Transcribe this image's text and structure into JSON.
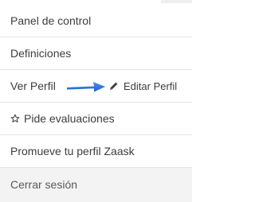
{
  "menu": {
    "items": [
      {
        "label": "Panel de control"
      },
      {
        "label": "Definiciones"
      },
      {
        "label": "Ver Perfil",
        "secondary_label": "Editar Perfil"
      },
      {
        "label": "Pide evaluaciones"
      },
      {
        "label": "Promueve tu perfil Zaask"
      },
      {
        "label": "Cerrar sesión"
      }
    ]
  },
  "annotation": {
    "arrow_color": "#2a6fd6",
    "arrow_icon": "arrow-right-icon"
  },
  "icons": {
    "edit": "pencil-icon",
    "evaluations": "star-outline-icon"
  }
}
